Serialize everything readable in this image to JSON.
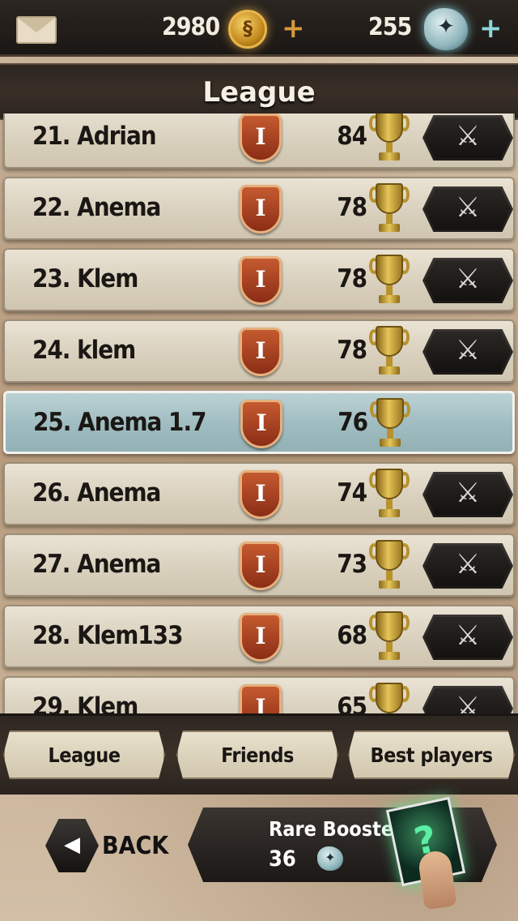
{
  "header": {
    "gold_amount": "2980",
    "gem_amount": "255",
    "plus_symbol": "+"
  },
  "title": "League",
  "rows": [
    {
      "rank_name": "21. Adrian",
      "league": "I",
      "score": "84",
      "highlighted": false
    },
    {
      "rank_name": "22. Anema",
      "league": "I",
      "score": "78",
      "highlighted": false
    },
    {
      "rank_name": "23. Klem",
      "league": "I",
      "score": "78",
      "highlighted": false
    },
    {
      "rank_name": "24. klem",
      "league": "I",
      "score": "78",
      "highlighted": false
    },
    {
      "rank_name": "25. Anema 1.7",
      "league": "I",
      "score": "76",
      "highlighted": true
    },
    {
      "rank_name": "26. Anema",
      "league": "I",
      "score": "74",
      "highlighted": false
    },
    {
      "rank_name": "27. Anema",
      "league": "I",
      "score": "73",
      "highlighted": false
    },
    {
      "rank_name": "28. Klem133",
      "league": "I",
      "score": "68",
      "highlighted": false
    },
    {
      "rank_name": "29. Klem",
      "league": "I",
      "score": "65",
      "highlighted": false
    }
  ],
  "tabs": {
    "league": "League",
    "friends": "Friends",
    "best_players": "Best players"
  },
  "back_label": "BACK",
  "booster": {
    "title": "Rare Booster",
    "cost": "36",
    "card_symbol": "?"
  },
  "icons": {
    "mail": "envelope-icon",
    "gold": "gold-coin-icon",
    "gem": "rune-gem-icon",
    "league": "shield-icon",
    "trophy": "trophy-icon",
    "fight": "crossed-swords-icon",
    "back": "back-arrow-icon"
  },
  "colors": {
    "highlight_row": "#a8c4c8",
    "row_paper": "#ddd4c2",
    "dark_frame": "#2b2622",
    "shield": "#b04a26"
  }
}
